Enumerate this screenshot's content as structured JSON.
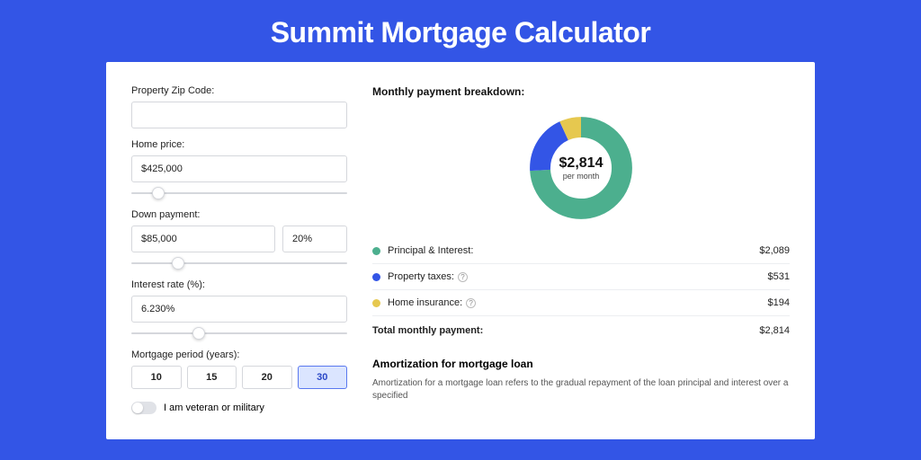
{
  "page": {
    "title": "Summit Mortgage Calculator"
  },
  "form": {
    "zip": {
      "label": "Property Zip Code:",
      "value": ""
    },
    "price": {
      "label": "Home price:",
      "value": "$425,000",
      "slider_pct": 10
    },
    "down": {
      "label": "Down payment:",
      "amount": "$85,000",
      "pct": "20%",
      "slider_pct": 20
    },
    "rate": {
      "label": "Interest rate (%):",
      "value": "6.230%",
      "slider_pct": 30
    },
    "period": {
      "label": "Mortgage period (years):",
      "options": [
        "10",
        "15",
        "20",
        "30"
      ],
      "selected": "30"
    },
    "veteran": {
      "label": "I am veteran or military",
      "checked": false
    }
  },
  "breakdown": {
    "title": "Monthly payment breakdown:",
    "center_amount": "$2,814",
    "center_sub": "per month",
    "rows": [
      {
        "label": "Principal & Interest:",
        "value": "$2,089",
        "color": "green",
        "help": false
      },
      {
        "label": "Property taxes:",
        "value": "$531",
        "color": "blue",
        "help": true
      },
      {
        "label": "Home insurance:",
        "value": "$194",
        "color": "yellow",
        "help": true
      }
    ],
    "total": {
      "label": "Total monthly payment:",
      "value": "$2,814"
    }
  },
  "amort": {
    "title": "Amortization for mortgage loan",
    "text": "Amortization for a mortgage loan refers to the gradual repayment of the loan principal and interest over a specified"
  },
  "chart_data": {
    "type": "pie",
    "title": "Monthly payment breakdown",
    "series": [
      {
        "name": "Principal & Interest",
        "value": 2089,
        "color": "#4CAF8E"
      },
      {
        "name": "Property taxes",
        "value": 531,
        "color": "#3355E6"
      },
      {
        "name": "Home insurance",
        "value": 194,
        "color": "#E6C84F"
      }
    ],
    "total": 2814,
    "center_label": "$2,814 per month"
  }
}
